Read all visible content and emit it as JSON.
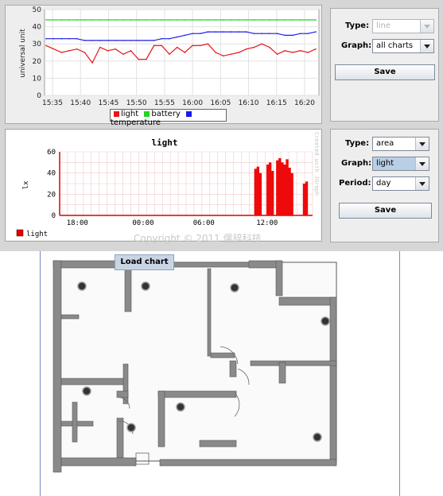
{
  "top_chart": {
    "ylabel": "universal unit",
    "y_ticks": [
      "50",
      "40",
      "30",
      "20",
      "10",
      "0"
    ],
    "x_ticks": [
      "15:35",
      "15:40",
      "15:45",
      "15:50",
      "15:55",
      "16:00",
      "16:05",
      "16:10",
      "16:15",
      "16:20"
    ],
    "legend": [
      {
        "label": "light",
        "color": "#e8141b"
      },
      {
        "label": "battery",
        "color": "#22d522"
      },
      {
        "label": "temperature",
        "color": "#1a1aec"
      }
    ]
  },
  "top_controls": {
    "type_label": "Type:",
    "type_value": "line",
    "graph_label": "Graph:",
    "graph_value": "all charts",
    "save_label": "Save"
  },
  "bottom_chart": {
    "title": "light",
    "ylabel": "lx",
    "y_ticks": [
      "60",
      "40",
      "20",
      "0"
    ],
    "x_ticks": [
      "18:00",
      "00:00",
      "06:00",
      "12:00"
    ],
    "legend": "light",
    "watermark": "Created with JGraph"
  },
  "bottom_controls": {
    "type_label": "Type:",
    "type_value": "area",
    "graph_label": "Graph:",
    "graph_value": "light",
    "period_label": "Period:",
    "period_value": "day",
    "save_label": "Save"
  },
  "copyright": "Copyright © 2011 儒辞科技",
  "load_chart_label": "Load chart",
  "colors": {
    "light": "#e8141b",
    "battery": "#22d522",
    "temperature": "#1a1aec",
    "area_fill": "#ee0a0a"
  },
  "chart_data": [
    {
      "type": "line",
      "title": "",
      "xlabel": "",
      "ylabel": "universal unit",
      "ylim": [
        0,
        50
      ],
      "x": [
        "15:35",
        "15:40",
        "15:45",
        "15:50",
        "15:55",
        "16:00",
        "16:05",
        "16:10",
        "16:15",
        "16:20"
      ],
      "series": [
        {
          "name": "light",
          "values": [
            29,
            27,
            25,
            26,
            27,
            25,
            19,
            28,
            26,
            27,
            24,
            26,
            21,
            21,
            29,
            29,
            24,
            28,
            25,
            29,
            29,
            30,
            25,
            23,
            24,
            25,
            27,
            28,
            30,
            28,
            24,
            26,
            25,
            26,
            25,
            27
          ]
        },
        {
          "name": "battery",
          "values": [
            44,
            44,
            44,
            44,
            44,
            44,
            44,
            44,
            44,
            44,
            44,
            44,
            44,
            44,
            44,
            44,
            44,
            44,
            44,
            44,
            44,
            44,
            44,
            44,
            44,
            44,
            44,
            44,
            44,
            44,
            44,
            44,
            44,
            44,
            44,
            44
          ]
        },
        {
          "name": "temperature",
          "values": [
            33,
            33,
            33,
            33,
            33,
            32,
            32,
            32,
            32,
            32,
            32,
            32,
            32,
            32,
            32,
            33,
            33,
            34,
            35,
            36,
            36,
            37,
            37,
            37,
            37,
            37,
            37,
            36,
            36,
            36,
            36,
            35,
            35,
            36,
            36,
            37
          ]
        }
      ],
      "grid": true,
      "legend_position": "bottom"
    },
    {
      "type": "area",
      "title": "light",
      "xlabel": "",
      "ylabel": "lx",
      "ylim": [
        0,
        60
      ],
      "x": [
        "18:00",
        "00:00",
        "06:00",
        "12:00"
      ],
      "series": [
        {
          "name": "light",
          "values": [
            0,
            0,
            0,
            0,
            0,
            0,
            0,
            0,
            0,
            0,
            0,
            0,
            0,
            0,
            0,
            0,
            0,
            0,
            0,
            0,
            0,
            0,
            0,
            0,
            0,
            0,
            0,
            0,
            0,
            0,
            0,
            0,
            0,
            0,
            0,
            0,
            0,
            0,
            0,
            0,
            0,
            0,
            0,
            0,
            0,
            0,
            0,
            0,
            0,
            0,
            0,
            0,
            0,
            0,
            0,
            0,
            0,
            0,
            0,
            0,
            0,
            0,
            0,
            0,
            0,
            0,
            0,
            0,
            0,
            0,
            0,
            0,
            0,
            0,
            0,
            0,
            0,
            0,
            0,
            0,
            44,
            46,
            40,
            0,
            0,
            48,
            50,
            42,
            0,
            52,
            54,
            50,
            48,
            53,
            45,
            40,
            0,
            0,
            0,
            0,
            30,
            32,
            0,
            0
          ]
        }
      ],
      "grid": true,
      "legend_position": "bottom-left"
    }
  ]
}
